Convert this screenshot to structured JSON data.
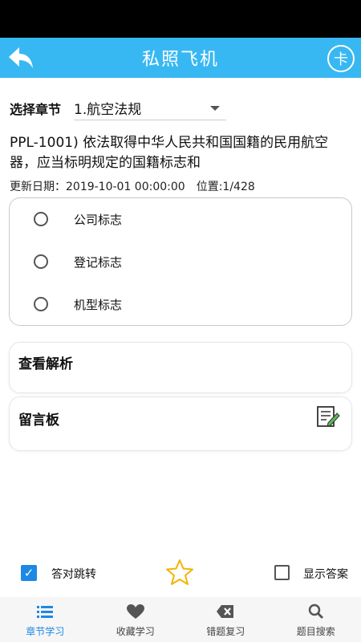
{
  "app_bar": {
    "title": "私照飞机",
    "card_label": "卡"
  },
  "chapter": {
    "label": "选择章节",
    "selected": "1.航空法规"
  },
  "question": {
    "text": "PPL-1001) 依法取得中华人民共和国国籍的民用航空器，应当标明规定的国籍标志和",
    "updated": "更新日期：2019-10-01 00:00:00",
    "position": "位置:1/428"
  },
  "options": [
    {
      "label": "公司标志"
    },
    {
      "label": "登记标志"
    },
    {
      "label": "机型标志"
    }
  ],
  "analysis": {
    "title": "查看解析"
  },
  "message_board": {
    "title": "留言板"
  },
  "controls": {
    "auto_jump_label": "答对跳转",
    "auto_jump_checked": true,
    "show_answer_label": "显示答案",
    "show_answer_checked": false
  },
  "tabs": [
    {
      "label": "章节学习",
      "icon": "list-icon",
      "active": true
    },
    {
      "label": "收藏学习",
      "icon": "heart-icon",
      "active": false
    },
    {
      "label": "错题复习",
      "icon": "delete-key-icon",
      "active": false
    },
    {
      "label": "题目搜索",
      "icon": "search-icon",
      "active": false
    }
  ],
  "colors": {
    "primary": "#38b8f2",
    "accent": "#1e88e5",
    "star": "#f4b400"
  }
}
